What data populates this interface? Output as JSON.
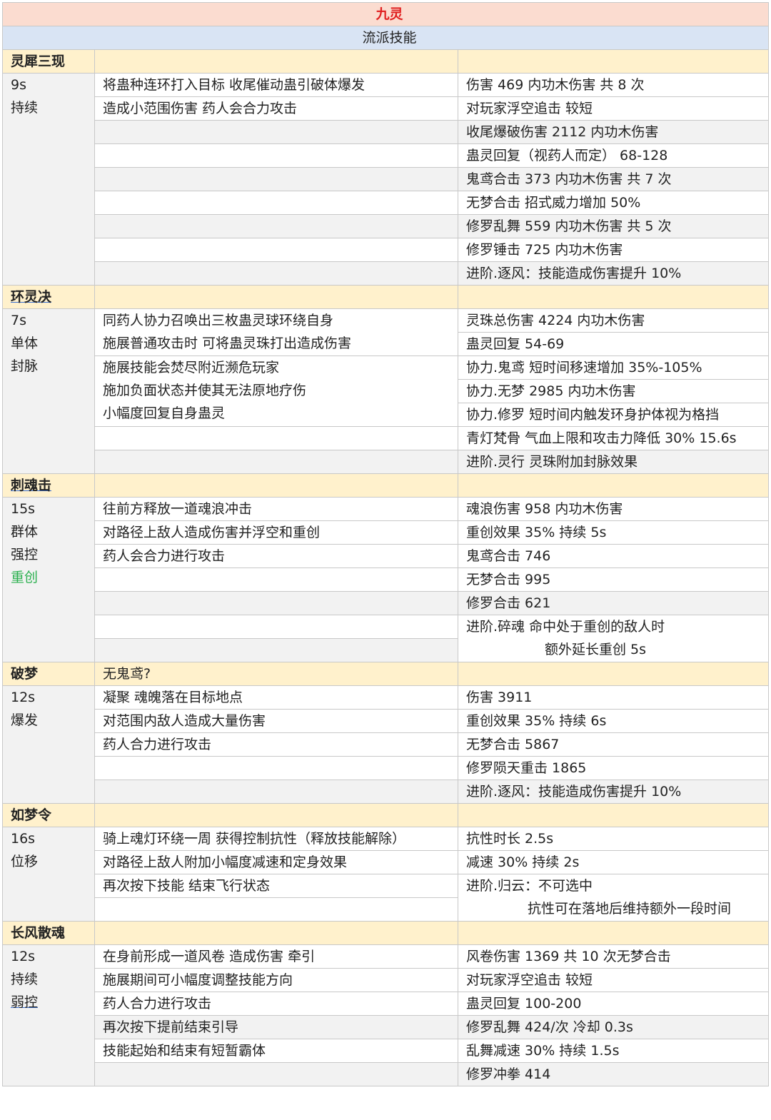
{
  "title": "九灵",
  "subtitle": "流派技能",
  "sections": [
    {
      "name": "灵犀三现",
      "meta": [
        "9s",
        "持续"
      ],
      "desc": [
        "将蛊种连环打入目标 收尾催动蛊引破体爆发",
        "造成小范围伤害 药人会合力攻击",
        "",
        "",
        "",
        "",
        "",
        "",
        ""
      ],
      "effects": [
        "伤害 469 内功木伤害 共 8 次",
        "对玩家浮空追击 较短",
        "收尾爆破伤害 2112 内功木伤害",
        "蛊灵回复（视药人而定） 68-128",
        "鬼鸢合击 373 内功木伤害 共 7 次",
        "无梦合击 招式威力增加 50%",
        "修罗乱舞 559 内功木伤害 共 5 次",
        "修罗锤击 725 内功木伤害",
        "进阶.逐风：技能造成伤害提升 10%"
      ]
    },
    {
      "name": "环灵决",
      "meta": [
        "7s",
        "单体",
        "封脉"
      ],
      "desc": [
        "同药人协力召唤出三枚蛊灵球环绕自身",
        "施展普通攻击时 可将蛊灵珠打出造成伤害",
        "施展技能会焚尽附近濒危玩家",
        "施加负面状态并使其无法原地疗伤",
        "小幅度回复自身蛊灵",
        "",
        ""
      ],
      "effects": [
        "灵珠总伤害 4224 内功木伤害",
        "蛊灵回复 54-69",
        "协力.鬼鸢 短时间移速增加 35%-105%",
        "协力.无梦 2985 内功木伤害",
        "协力.修罗 短时间内触发环身护体视为格挡",
        "青灯梵骨 气血上限和攻击力降低 30% 15.6s",
        "进阶.灵行 灵珠附加封脉效果"
      ]
    },
    {
      "name": "刺魂击",
      "meta": [
        "15s",
        "群体",
        "强控",
        "重创"
      ],
      "desc": [
        "往前方释放一道魂浪冲击",
        "对路径上敌人造成伤害并浮空和重创",
        "药人会合力进行攻击",
        "",
        "",
        "",
        ""
      ],
      "effects": [
        "魂浪伤害 958 内功木伤害",
        "重创效果 35% 持续 5s",
        "鬼鸢合击 746",
        "无梦合击 995",
        "修罗合击 621",
        "进阶.碎魂 命中处于重创的敌人时",
        "额外延长重创 5s"
      ]
    },
    {
      "name": "破梦",
      "note": "无鬼鸢?",
      "meta": [
        "12s",
        "爆发"
      ],
      "desc": [
        "凝聚 魂魄落在目标地点",
        "对范围内敌人造成大量伤害",
        "药人合力进行攻击",
        "",
        ""
      ],
      "effects": [
        "伤害 3911",
        "重创效果 35% 持续 6s",
        "无梦合击 5867",
        "修罗陨天重击 1865",
        "进阶.逐风：技能造成伤害提升 10%"
      ]
    },
    {
      "name": "如梦令",
      "meta": [
        "16s",
        "位移"
      ],
      "desc": [
        "骑上魂灯环绕一周 获得控制抗性（释放技能解除）",
        "对路径上敌人附加小幅度减速和定身效果",
        "再次按下技能 结束飞行状态",
        ""
      ],
      "effects": [
        "抗性时长 2.5s",
        "减速 30% 持续 2s",
        "进阶.归云：不可选中",
        "抗性可在落地后维持额外一段时间"
      ]
    },
    {
      "name": "长风散魂",
      "meta": [
        "12s",
        "持续",
        "弱控"
      ],
      "desc": [
        "在身前形成一道风卷 造成伤害 牵引",
        "施展期间可小幅度调整技能方向",
        "药人合力进行攻击",
        "再次按下提前结束引导",
        "技能起始和结束有短暂霸体",
        ""
      ],
      "effects": [
        "风卷伤害 1369 共 10 次无梦合击",
        "对玩家浮空追击 较短",
        "蛊灵回复 100-200",
        "修罗乱舞 424/次 冷却 0.3s",
        "乱舞减速 30% 持续 1.5s",
        "修罗冲拳 414"
      ]
    }
  ]
}
